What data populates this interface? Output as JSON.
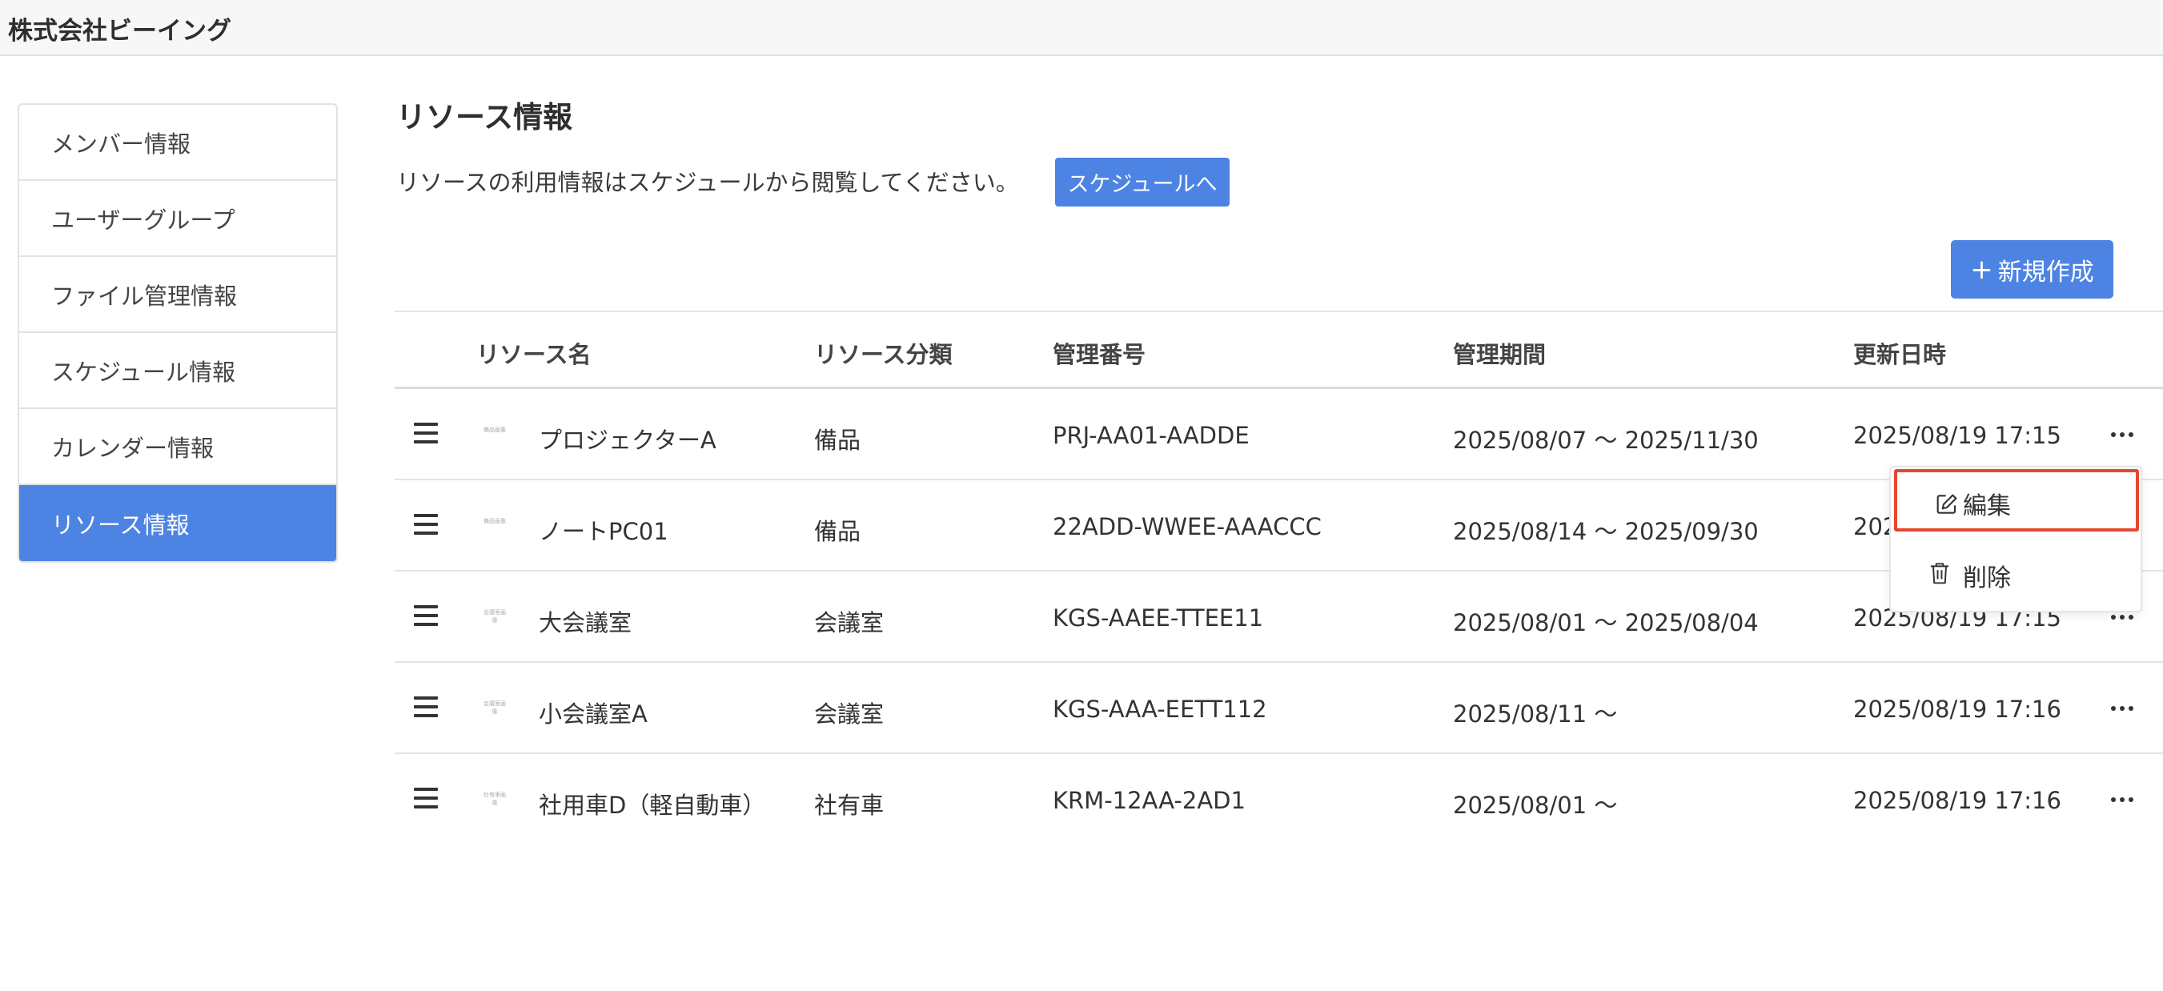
{
  "header": {
    "company": "株式会社ビーイング"
  },
  "sidebar": {
    "items": [
      {
        "label": "メンバー情報",
        "active": false
      },
      {
        "label": "ユーザーグループ",
        "active": false
      },
      {
        "label": "ファイル管理情報",
        "active": false
      },
      {
        "label": "スケジュール情報",
        "active": false
      },
      {
        "label": "カレンダー情報",
        "active": false
      },
      {
        "label": "リソース情報",
        "active": true
      }
    ]
  },
  "main": {
    "title": "リソース情報",
    "description": "リソースの利用情報はスケジュールから閲覧してください。",
    "schedule_button": "スケジュールへ",
    "new_button": "新規作成",
    "new_button_icon": "+",
    "columns": {
      "name": "リソース名",
      "category": "リソース分類",
      "number": "管理番号",
      "period": "管理期間",
      "updated": "更新日時"
    },
    "rows": [
      {
        "thumb": "備品画像",
        "name": "プロジェクターA",
        "category": "備品",
        "number": "PRJ-AA01-AADDE",
        "period": "2025/08/07 〜 2025/11/30",
        "updated": "2025/08/19 17:15"
      },
      {
        "thumb": "備品画像",
        "name": "ノートPC01",
        "category": "備品",
        "number": "22ADD-WWEE-AAACCC",
        "period": "2025/08/14 〜 2025/09/30",
        "updated": "2025/08/19 17:15"
      },
      {
        "thumb": "会議室画像",
        "name": "大会議室",
        "category": "会議室",
        "number": "KGS-AAEE-TTEE11",
        "period": "2025/08/01 〜 2025/08/04",
        "updated": "2025/08/19 17:15"
      },
      {
        "thumb": "会議室画像",
        "name": "小会議室A",
        "category": "会議室",
        "number": "KGS-AAA-EETT112",
        "period": "2025/08/11 〜",
        "updated": "2025/08/19 17:16"
      },
      {
        "thumb": "社有車画像",
        "name": "社用車D（軽自動車）",
        "category": "社有車",
        "number": "KRM-12AA-2AD1",
        "period": "2025/08/01 〜",
        "updated": "2025/08/19 17:16"
      }
    ]
  },
  "context_menu": {
    "edit": "編集",
    "delete": "削除",
    "highlight_color": "#e4462f"
  },
  "colors": {
    "accent": "#4d84e3"
  }
}
